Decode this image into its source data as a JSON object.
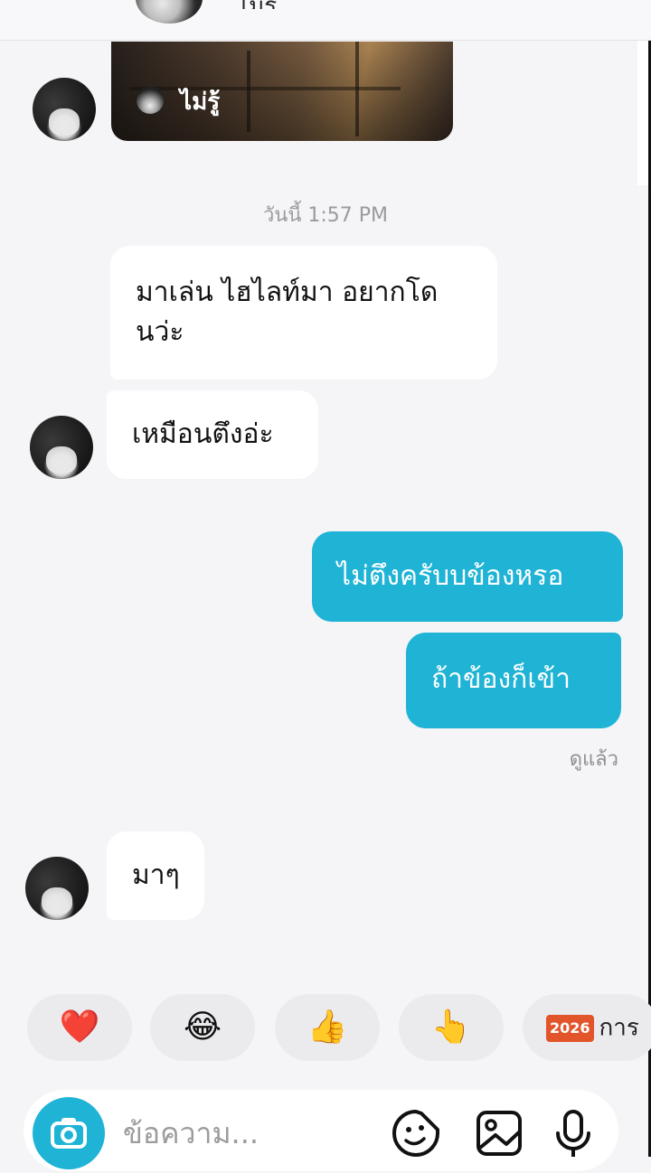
{
  "header": {
    "title_partial": "ไม่รู้"
  },
  "story": {
    "label": "ไม่รู้"
  },
  "timestamp": "วันนี้ 1:57 PM",
  "messages": [
    {
      "from": "them",
      "text": "มาเล่น ไฮไลท์มา อยากโดนว่ะ"
    },
    {
      "from": "them",
      "text": "เหมือนตึงอ่ะ"
    },
    {
      "from": "me",
      "text": "ไม่ตึงครับบข้องหรอ"
    },
    {
      "from": "me",
      "text": "ถ้าข้องก็เข้า"
    },
    {
      "from": "them",
      "text": "มาๆ"
    }
  ],
  "seen_label": "ดูแล้ว",
  "reactions": [
    {
      "emoji": "❤️",
      "icon": "heart-icon"
    },
    {
      "emoji": "😂",
      "icon": "laugh-icon"
    },
    {
      "emoji": "👍",
      "icon": "thumbs-up-icon"
    },
    {
      "emoji": "👆",
      "icon": "point-up-icon"
    },
    {
      "badge": "2026",
      "text": "การ"
    }
  ],
  "composer": {
    "placeholder": "ข้อความ..."
  },
  "colors": {
    "accent": "#1fb3d6",
    "bubble_in": "#ffffff",
    "background": "#f5f5f7"
  }
}
